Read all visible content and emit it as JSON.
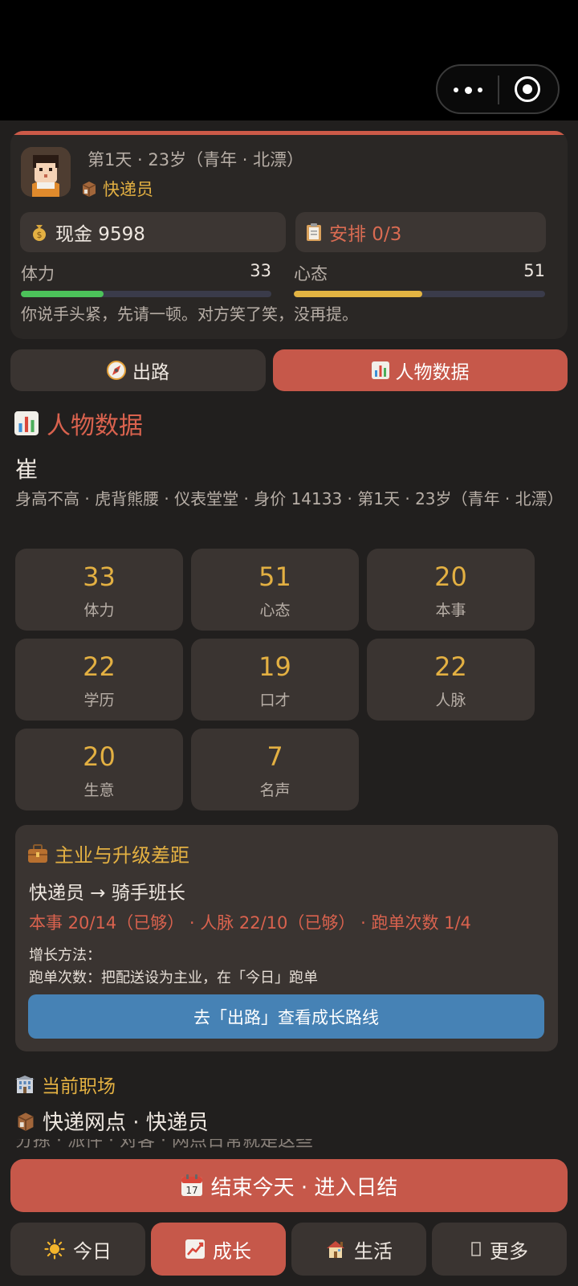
{
  "status": {
    "day_line": "第1天 · 23岁（青年 · 北漂）",
    "job": "快递员",
    "cash_label": "现金 9598",
    "plan_label": "安排 0/3",
    "stamina": {
      "label": "体力",
      "value": "33",
      "level": 0.33,
      "color": "#4cc35a"
    },
    "mood": {
      "label": "心态",
      "value": "51",
      "level": 0.51,
      "color": "#e3b442"
    },
    "message": "你说手头紧，先请一顿。对方笑了笑，没再提。"
  },
  "tabs": [
    {
      "label": "出路",
      "icon": "compass-icon"
    },
    {
      "label": "人物数据",
      "icon": "chart-icon"
    }
  ],
  "profile": {
    "title": "人物数据",
    "name": "崔",
    "description": "身高不高 · 虎背熊腰 · 仪表堂堂 · 身价 14133 · 第1天 · 23岁（青年 · 北漂）",
    "stats": [
      {
        "value": "33",
        "label": "体力"
      },
      {
        "value": "51",
        "label": "心态"
      },
      {
        "value": "20",
        "label": "本事"
      },
      {
        "value": "22",
        "label": "学历"
      },
      {
        "value": "19",
        "label": "口才"
      },
      {
        "value": "22",
        "label": "人脉"
      },
      {
        "value": "20",
        "label": "生意"
      },
      {
        "value": "7",
        "label": "名声"
      }
    ]
  },
  "career": {
    "title": "主业与升级差距",
    "path": "快递员 → 骑手班长",
    "requirements": "本事 20/14（已够） · 人脉 22/10（已够） · 跑单次数 1/4",
    "method_title": "增长方法：",
    "method": "跑单次数：把配送设为主业，在「今日」跑单",
    "button": "去「出路」查看成长路线"
  },
  "workplace": {
    "title": "当前职场",
    "line": "快递网点 · 快递员",
    "peek": "分拣 · 派件 · 对客 · 网点日常就是这些"
  },
  "end_day_button": "结束今天 · 进入日结",
  "bottom_nav": [
    {
      "label": "今日",
      "icon": "sun-icon"
    },
    {
      "label": "成长",
      "icon": "growth-chart-icon",
      "active": true
    },
    {
      "label": "生活",
      "icon": "house-icon"
    },
    {
      "label": "更多",
      "icon": "more-icon"
    }
  ],
  "colors": {
    "accent": "#c6584a",
    "gold": "#e3b042",
    "blue_button": "#4682b5"
  }
}
